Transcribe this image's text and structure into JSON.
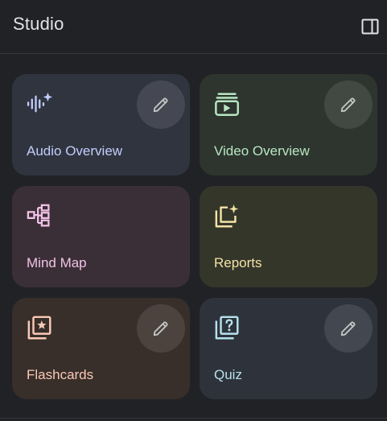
{
  "header": {
    "title": "Studio"
  },
  "cards": [
    {
      "label": "Audio Overview",
      "icon": "audio-sparkle-icon",
      "has_edit": true,
      "bg": "#30343f",
      "accent": "#c3cdfc"
    },
    {
      "label": "Video Overview",
      "icon": "video-stack-icon",
      "has_edit": true,
      "bg": "#2d352e",
      "accent": "#b8e6c2"
    },
    {
      "label": "Mind Map",
      "icon": "mind-map-icon",
      "has_edit": false,
      "bg": "#3b2f37",
      "accent": "#f0c3e6"
    },
    {
      "label": "Reports",
      "icon": "reports-sparkle-icon",
      "has_edit": false,
      "bg": "#35362a",
      "accent": "#f2e2a6"
    },
    {
      "label": "Flashcards",
      "icon": "flashcards-star-icon",
      "has_edit": true,
      "bg": "#382e2a",
      "accent": "#f9c9b6"
    },
    {
      "label": "Quiz",
      "icon": "quiz-icon",
      "has_edit": true,
      "bg": "#2e333b",
      "accent": "#b6e2ee"
    }
  ]
}
